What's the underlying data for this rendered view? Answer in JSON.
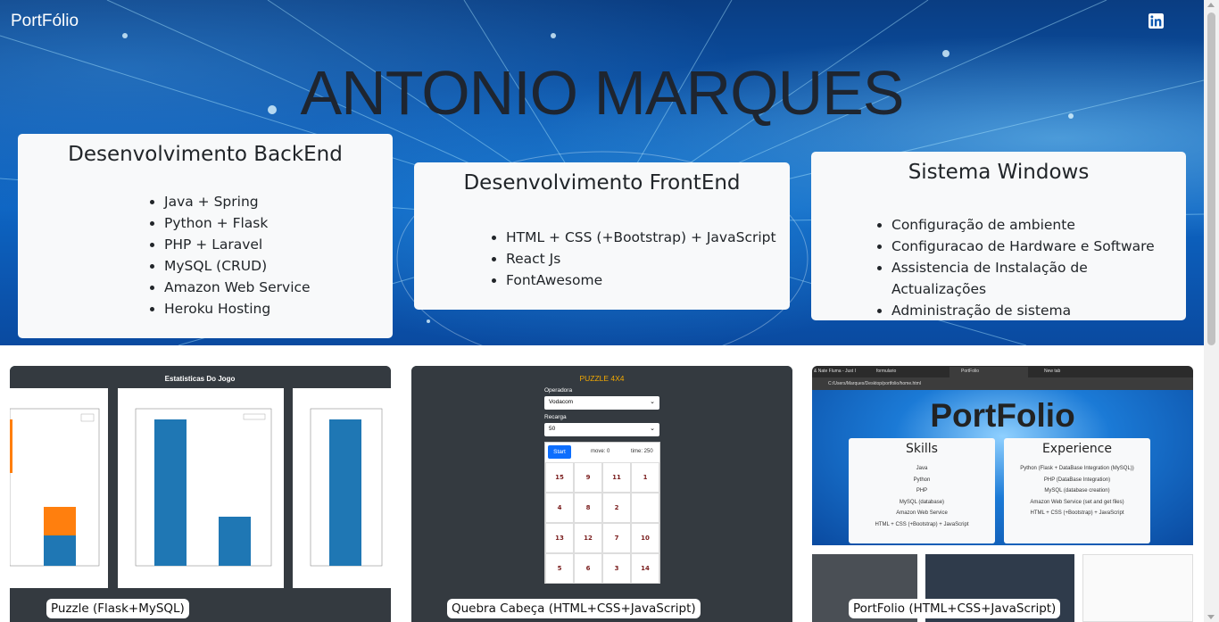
{
  "navbar": {
    "brand": "PortFólio",
    "icons": [
      "github-icon",
      "linkedin-icon"
    ]
  },
  "hero": {
    "title": "ANTONIO MARQUES"
  },
  "skills": [
    {
      "title": "Desenvolvimento BackEnd",
      "items": [
        "Java + Spring",
        "Python + Flask",
        "PHP + Laravel",
        "MySQL (CRUD)",
        "Amazon Web Service",
        "Heroku Hosting"
      ]
    },
    {
      "title": "Desenvolvimento FrontEnd",
      "items": [
        "HTML + CSS (+Bootstrap) + JavaScript",
        "React Js",
        "FontAwesome"
      ]
    },
    {
      "title": "Sistema Windows",
      "items": [
        "Configuração de ambiente",
        "Configuracao de Hardware e Software",
        "Assistencia de Instalação de Actualizações",
        "Administração de sistema"
      ]
    }
  ],
  "projects": [
    {
      "caption": "Puzzle (Flask+MySQL)",
      "preview_title": "Estatisticas Do Jogo"
    },
    {
      "caption": "Quebra Cabeça (HTML+CSS+JavaScript)",
      "preview": {
        "title": "PUZZLE 4X4",
        "operadora_label": "Operadora",
        "operadora_value": "Vodacom",
        "recarga_label": "Recarga",
        "recarga_value": "50",
        "start": "Start",
        "move": "move: 0",
        "time": "time: 250",
        "grid": [
          "15",
          "9",
          "11",
          "1",
          "4",
          "8",
          "2",
          "",
          "13",
          "12",
          "7",
          "10",
          "5",
          "6",
          "3",
          "14"
        ]
      }
    },
    {
      "caption": "PortFolio (HTML+CSS+JavaScript)",
      "preview": {
        "title": "PortFolio",
        "skills_title": "Skills",
        "skills": [
          "Java",
          "Python",
          "PHP",
          "MySQL (database)",
          "Amazon Web Service",
          "HTML + CSS (+Bootstrap) + JavaScript"
        ],
        "experience_title": "Experience",
        "experience": [
          "Python (Flask + DataBase Integration (MySQL))",
          "PHP (DataBase Integration)",
          "MySQL (database creation)",
          "Amazon Web Service (set and get files)",
          "HTML + CSS (+Bootstrap) + JavaScript"
        ],
        "address": "C:/Users/Marques/Desktop/portfolio/home.html",
        "tabs": [
          "& Nate Fluma - Just I",
          "formulario",
          "PortFolio",
          "New tab"
        ]
      }
    }
  ],
  "colors": {
    "card_bg": "#f8f9fa",
    "project_bg": "#343a40",
    "bar": "#1f77b4",
    "bar_stack": "#ff7f0e",
    "start_button": "#0d6efd"
  }
}
